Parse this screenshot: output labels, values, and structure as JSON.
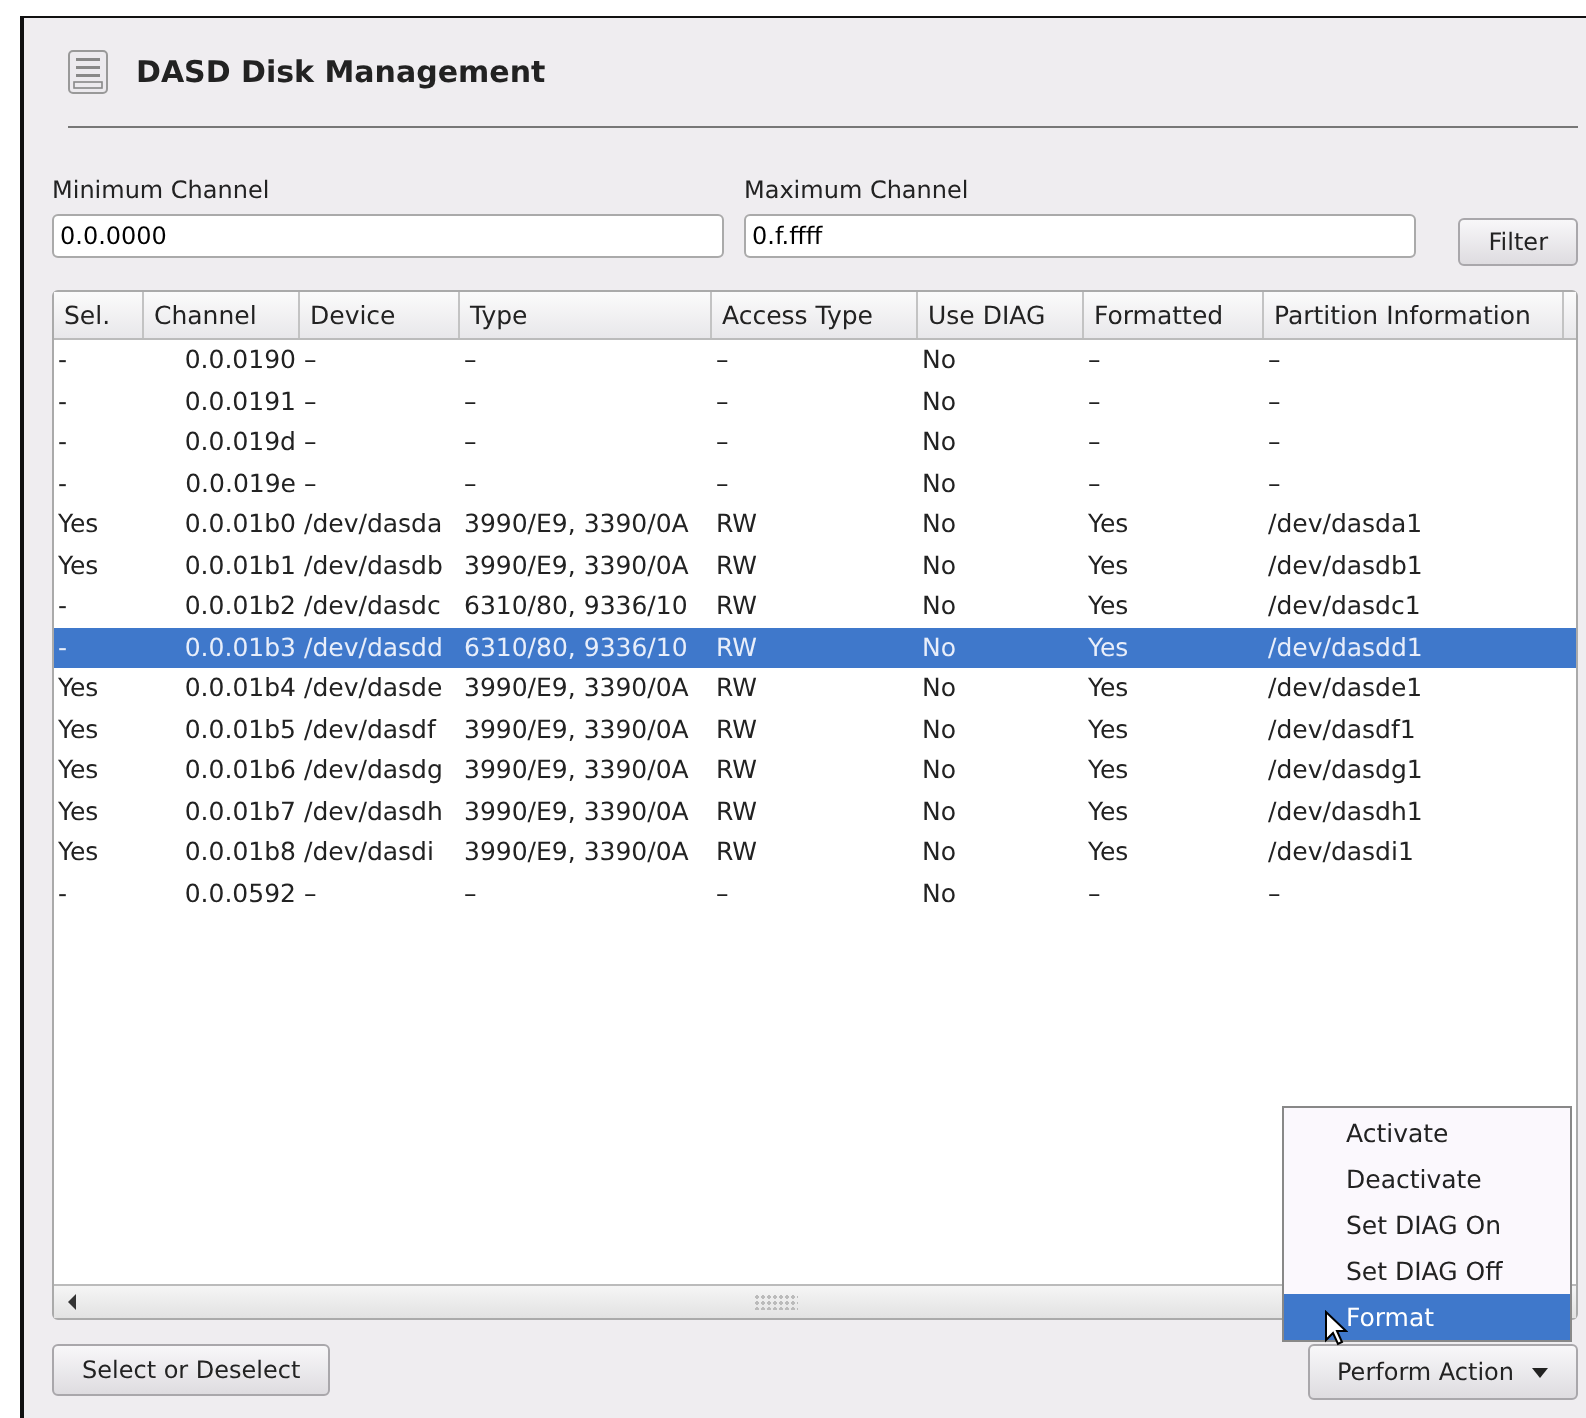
{
  "window": {
    "title": "DASD Disk Management"
  },
  "filters": [
    {
      "label": "Minimum Channel",
      "value": "0.0.0000"
    },
    {
      "label": "Maximum Channel",
      "value": "0.f.ffff"
    }
  ],
  "filter_button": "Filter",
  "table": {
    "columns": [
      "Sel.",
      "Channel",
      "Device",
      "Type",
      "Access Type",
      "Use DIAG",
      "Formatted",
      "Partition Information"
    ],
    "rows": [
      {
        "cells": [
          "-",
          "0.0.0190",
          "–",
          "–",
          "–",
          "No",
          "–",
          "–"
        ],
        "selected": false
      },
      {
        "cells": [
          "-",
          "0.0.0191",
          "–",
          "–",
          "–",
          "No",
          "–",
          "–"
        ],
        "selected": false
      },
      {
        "cells": [
          "-",
          "0.0.019d",
          "–",
          "–",
          "–",
          "No",
          "–",
          "–"
        ],
        "selected": false
      },
      {
        "cells": [
          "-",
          "0.0.019e",
          "–",
          "–",
          "–",
          "No",
          "–",
          "–"
        ],
        "selected": false
      },
      {
        "cells": [
          "Yes",
          "0.0.01b0",
          "/dev/dasda",
          "3990/E9, 3390/0A",
          "RW",
          "No",
          "Yes",
          "/dev/dasda1"
        ],
        "selected": false
      },
      {
        "cells": [
          "Yes",
          "0.0.01b1",
          "/dev/dasdb",
          "3990/E9, 3390/0A",
          "RW",
          "No",
          "Yes",
          "/dev/dasdb1"
        ],
        "selected": false
      },
      {
        "cells": [
          "-",
          "0.0.01b2",
          "/dev/dasdc",
          "6310/80, 9336/10",
          "RW",
          "No",
          "Yes",
          "/dev/dasdc1"
        ],
        "selected": false
      },
      {
        "cells": [
          "-",
          "0.0.01b3",
          "/dev/dasdd",
          "6310/80, 9336/10",
          "RW",
          "No",
          "Yes",
          "/dev/dasdd1"
        ],
        "selected": true
      },
      {
        "cells": [
          "Yes",
          "0.0.01b4",
          "/dev/dasde",
          "3990/E9, 3390/0A",
          "RW",
          "No",
          "Yes",
          "/dev/dasde1"
        ],
        "selected": false
      },
      {
        "cells": [
          "Yes",
          "0.0.01b5",
          "/dev/dasdf",
          "3990/E9, 3390/0A",
          "RW",
          "No",
          "Yes",
          "/dev/dasdf1"
        ],
        "selected": false
      },
      {
        "cells": [
          "Yes",
          "0.0.01b6",
          "/dev/dasdg",
          "3990/E9, 3390/0A",
          "RW",
          "No",
          "Yes",
          "/dev/dasdg1"
        ],
        "selected": false
      },
      {
        "cells": [
          "Yes",
          "0.0.01b7",
          "/dev/dasdh",
          "3990/E9, 3390/0A",
          "RW",
          "No",
          "Yes",
          "/dev/dasdh1"
        ],
        "selected": false
      },
      {
        "cells": [
          "Yes",
          "0.0.01b8",
          "/dev/dasdi",
          "3990/E9, 3390/0A",
          "RW",
          "No",
          "Yes",
          "/dev/dasdi1"
        ],
        "selected": false
      },
      {
        "cells": [
          "-",
          "0.0.0592",
          "–",
          "–",
          "–",
          "No",
          "–",
          "–"
        ],
        "selected": false
      }
    ]
  },
  "action_menu": {
    "items": [
      {
        "label": "Activate",
        "selected": false
      },
      {
        "label": "Deactivate",
        "selected": false
      },
      {
        "label": "Set DIAG On",
        "selected": false
      },
      {
        "label": "Set DIAG Off",
        "selected": false
      },
      {
        "label": "Format",
        "selected": true
      }
    ]
  },
  "buttons": {
    "left": "Select or Deselect",
    "right": "Perform Action"
  }
}
